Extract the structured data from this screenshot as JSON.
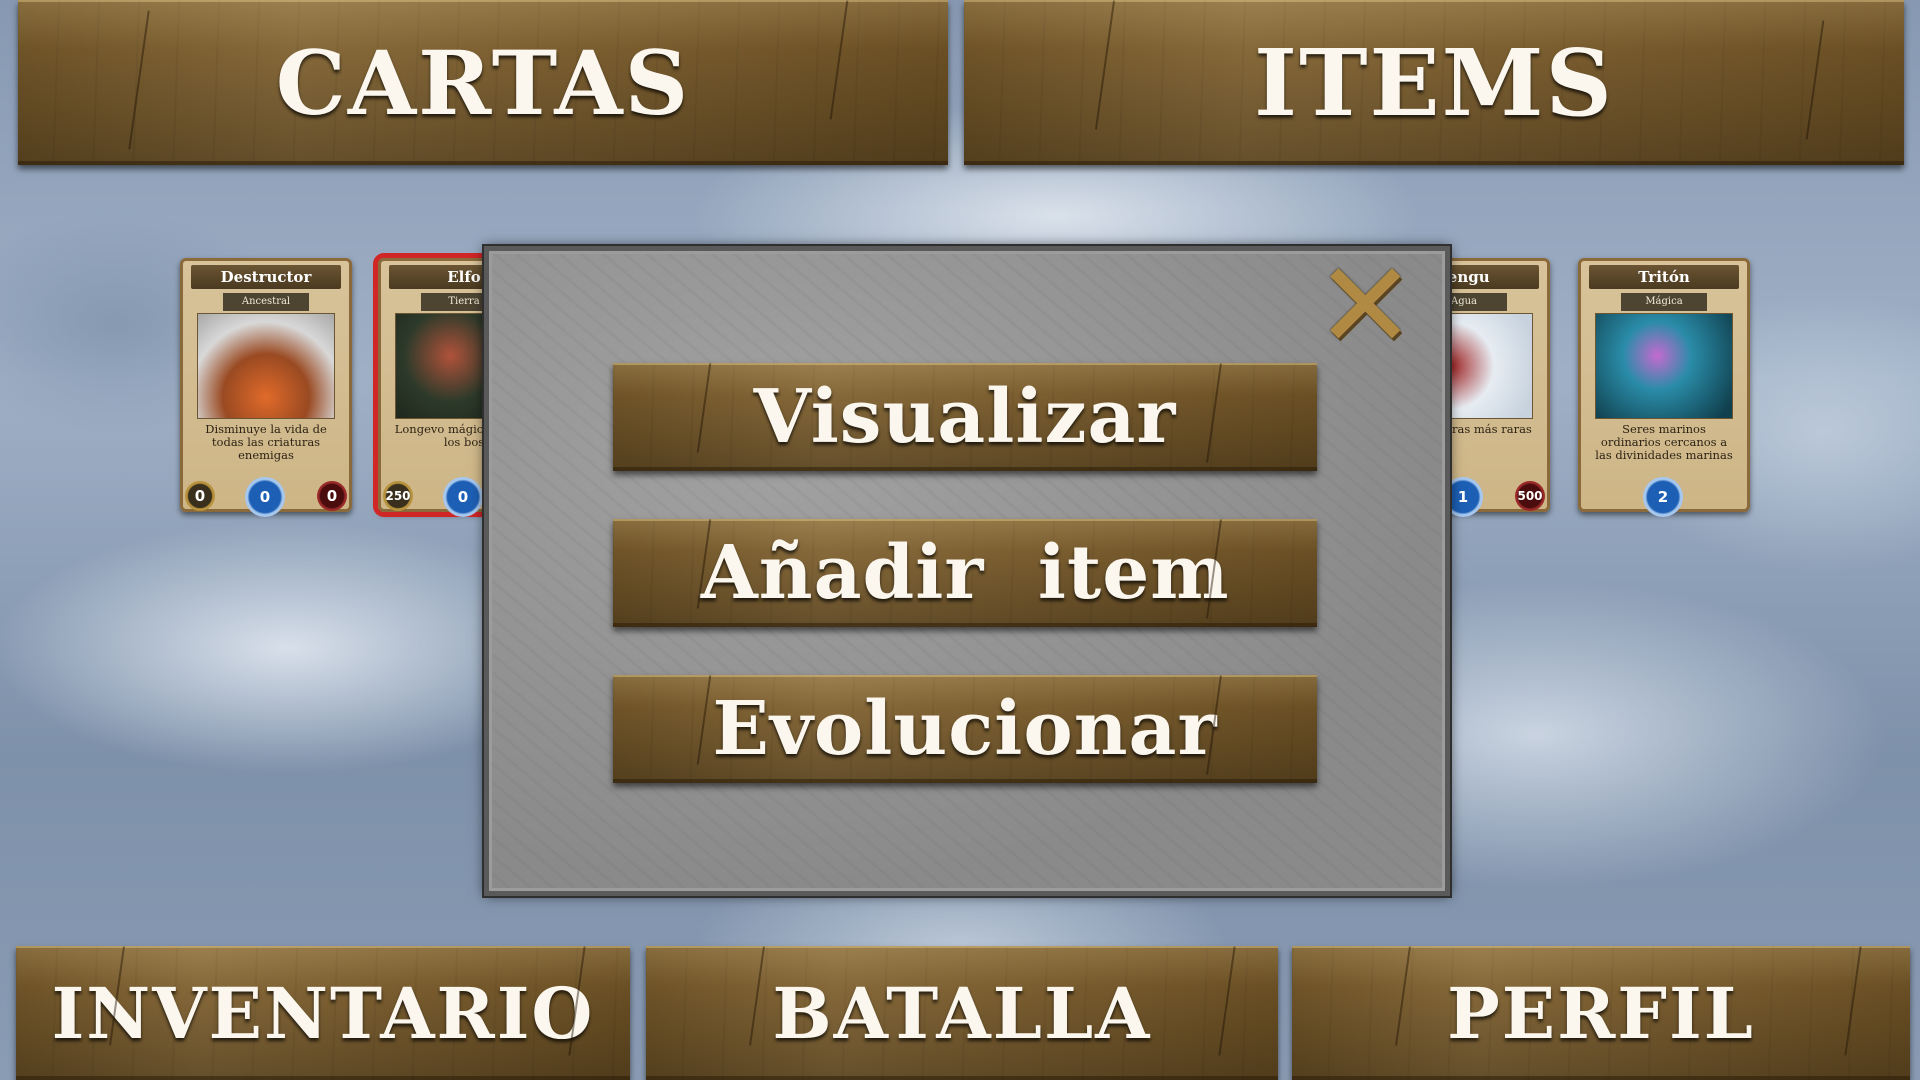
{
  "top_tabs": {
    "cartas": "CARTAS",
    "items": "ITEMS"
  },
  "cards": [
    {
      "name": "Destructor",
      "type": "Ancestral",
      "description": "Disminuye la vida de todas las criaturas enemigas",
      "stat_left": "0",
      "stat_center": "0",
      "stat_right": "0",
      "selected": false
    },
    {
      "name": "Elfo",
      "type": "Tierra",
      "description": "Longevo mágico que en los bos",
      "stat_left": "250",
      "stat_center": "0",
      "stat_right": "",
      "selected": true
    },
    {
      "name": "Tengu",
      "type": "Agua",
      "description": "n de las aras más raras",
      "stat_left": "",
      "stat_center": "1",
      "stat_right": "500",
      "selected": false
    },
    {
      "name": "Tritón",
      "type": "Mágica",
      "description": "Seres marinos ordinarios cercanos a las divinidades marinas",
      "stat_left": "",
      "stat_center": "2",
      "stat_right": "",
      "selected": false
    }
  ],
  "modal": {
    "close_symbol": "✕",
    "btn_visualizar": "Visualizar",
    "btn_anadir": "Añadir  item",
    "btn_evolucionar": "Evolucionar"
  },
  "bottom_nav": {
    "inventario": "INVENTARIO",
    "batalla": "BATALLA",
    "perfil": "PERFIL"
  },
  "colors": {
    "wood": "#7b5e30",
    "selection": "#d12626",
    "modal_bg": "#8f8f8f"
  }
}
